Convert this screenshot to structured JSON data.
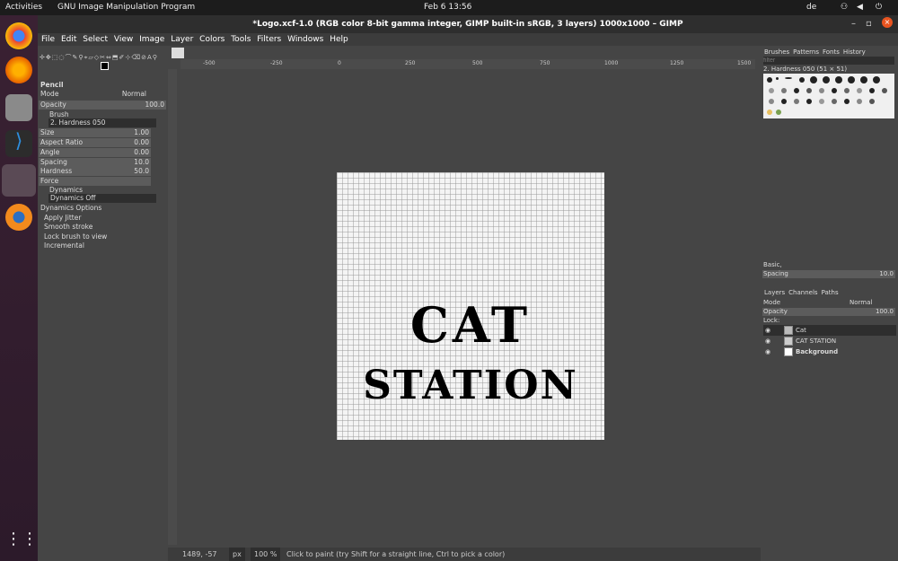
{
  "topbar": {
    "activities": "Activities",
    "app": "GNU Image Manipulation Program",
    "clock": "Feb 6  13:56",
    "lang": "de"
  },
  "window": {
    "title": "*Logo.xcf-1.0 (RGB color 8-bit gamma integer, GIMP built-in sRGB, 3 layers) 1000x1000 – GIMP"
  },
  "menu": [
    "File",
    "Edit",
    "Select",
    "View",
    "Image",
    "Layer",
    "Colors",
    "Tools",
    "Filters",
    "Windows",
    "Help"
  ],
  "tool_options": {
    "tool_name": "Pencil",
    "mode_label": "Mode",
    "mode_value": "Normal",
    "opacity_label": "Opacity",
    "opacity_value": "100.0",
    "brush_label": "Brush",
    "brush_value": "2. Hardness 050",
    "size_label": "Size",
    "size_value": "1.00",
    "aspect_label": "Aspect Ratio",
    "aspect_value": "0.00",
    "angle_label": "Angle",
    "angle_value": "0.00",
    "spacing_label": "Spacing",
    "spacing_value": "10.0",
    "hardness_label": "Hardness",
    "hardness_value": "50.0",
    "force_label": "Force",
    "dynamics_label": "Dynamics",
    "dynamics_value": "Dynamics Off",
    "dyn_options": "Dynamics Options",
    "jitter": "Apply Jitter",
    "smooth": "Smooth stroke",
    "lock": "Lock brush to view",
    "incremental": "Incremental"
  },
  "ruler": {
    "ticks": [
      "-500",
      "-250",
      "0",
      "250",
      "500",
      "750",
      "1000",
      "1250",
      "1500"
    ]
  },
  "image": {
    "line1": "CAT",
    "line2": "STATION"
  },
  "status": {
    "coords": "1489, -57",
    "unit": "px",
    "zoom": "100 %",
    "message": "Click to paint (try Shift for a straight line, Ctrl to pick a color)"
  },
  "right": {
    "tabs": [
      "Brushes",
      "Patterns",
      "Fonts",
      "History"
    ],
    "filter_placeholder": "filter",
    "brush_name": "2. Hardness 050 (51 × 51)",
    "basic": "Basic,",
    "spacing_label": "Spacing",
    "spacing_value": "10.0",
    "layer_tabs": [
      "Layers",
      "Channels",
      "Paths"
    ],
    "mode_label": "Mode",
    "mode_value": "Normal",
    "opacity_label": "Opacity",
    "opacity_value": "100.0",
    "lock_label": "Lock:",
    "layers": [
      "Cat",
      "CAT STATION",
      "Background"
    ]
  }
}
